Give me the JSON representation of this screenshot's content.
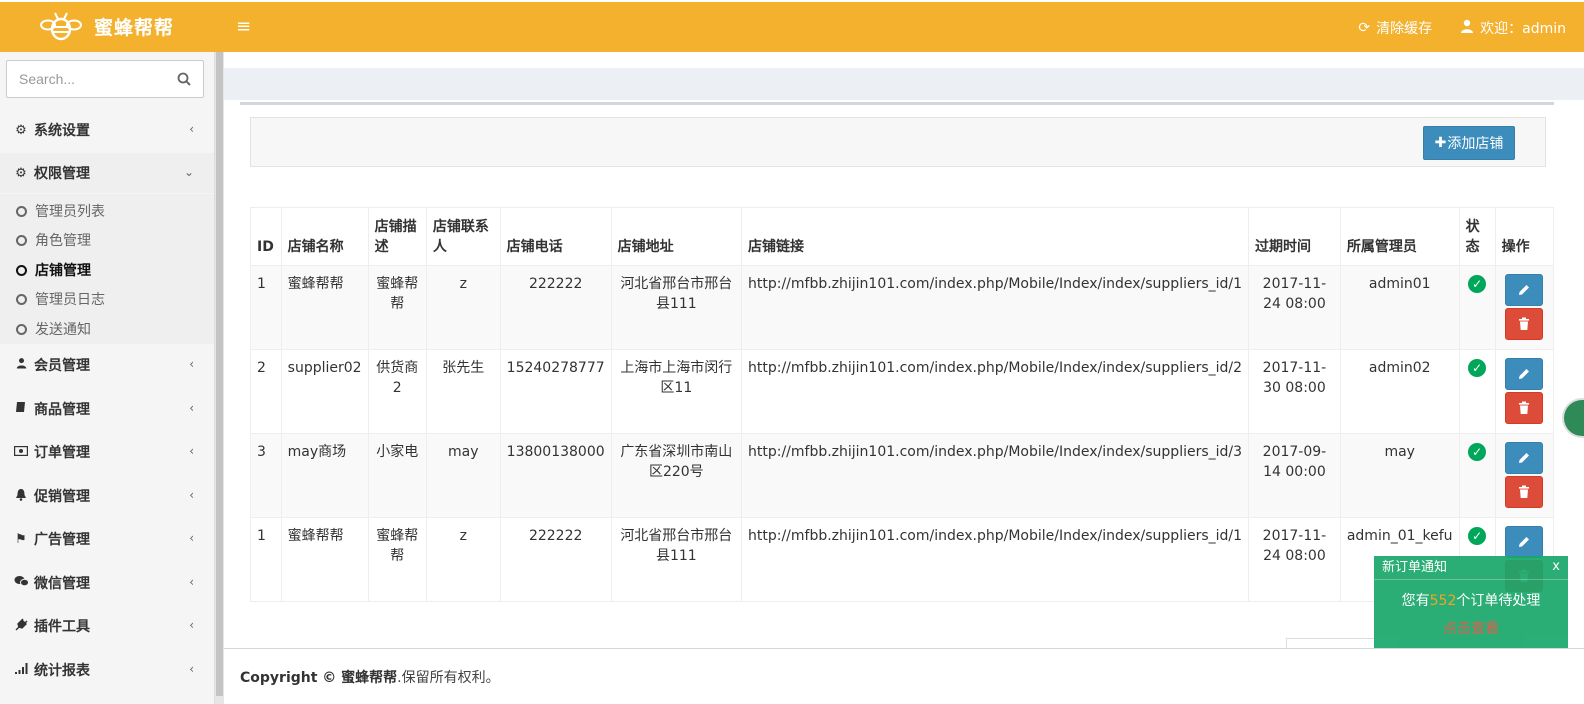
{
  "header": {
    "brand": "蜜蜂帮帮",
    "menu_toggle": "≡",
    "clear_cache": "清除缓存",
    "welcome": "欢迎：admin"
  },
  "sidebar": {
    "search_placeholder": "Search...",
    "items": [
      {
        "label": "系统设置",
        "icon": "gear-icon"
      },
      {
        "label": "权限管理",
        "icon": "gears-icon",
        "expanded": true
      },
      {
        "label": "会员管理",
        "icon": "user-icon"
      },
      {
        "label": "商品管理",
        "icon": "book-icon"
      },
      {
        "label": "订单管理",
        "icon": "money-icon"
      },
      {
        "label": "促销管理",
        "icon": "bell-icon"
      },
      {
        "label": "广告管理",
        "icon": "flag-icon"
      },
      {
        "label": "微信管理",
        "icon": "wechat-icon"
      },
      {
        "label": "插件工具",
        "icon": "plug-icon"
      },
      {
        "label": "统计报表",
        "icon": "signal-icon"
      }
    ],
    "submenu": [
      {
        "label": "管理员列表"
      },
      {
        "label": "角色管理"
      },
      {
        "label": "店铺管理",
        "active": true
      },
      {
        "label": "管理员日志"
      },
      {
        "label": "发送通知"
      }
    ]
  },
  "toolbar": {
    "add_label": "添加店铺"
  },
  "table": {
    "headers": [
      "ID",
      "店铺名称",
      "店铺描述",
      "店铺联系人",
      "店铺电话",
      "店铺地址",
      "店铺链接",
      "过期时间",
      "所属管理员",
      "状态",
      "操作"
    ],
    "rows": [
      {
        "id": "1",
        "name": "蜜蜂帮帮",
        "desc": "蜜蜂帮帮",
        "contact": "z",
        "phone": "222222",
        "address": "河北省邢台市邢台县111",
        "link": "http://mfbb.zhijin101.com/index.php/Mobile/Index/index/suppliers_id/1",
        "expire": "2017-11-24 08:00",
        "admin": "admin01",
        "status": "enabled"
      },
      {
        "id": "2",
        "name": "supplier02",
        "desc": "供货商2",
        "contact": "张先生",
        "phone": "15240278777",
        "address": "上海市上海市闵行区11",
        "link": "http://mfbb.zhijin101.com/index.php/Mobile/Index/index/suppliers_id/2",
        "expire": "2017-11-30 08:00",
        "admin": "admin02",
        "status": "enabled"
      },
      {
        "id": "3",
        "name": "may商场",
        "desc": "小家电",
        "contact": "may",
        "phone": "13800138000",
        "address": "广东省深圳市南山区220号",
        "link": "http://mfbb.zhijin101.com/index.php/Mobile/Index/index/suppliers_id/3",
        "expire": "2017-09-14 00:00",
        "admin": "may",
        "status": "enabled"
      },
      {
        "id": "1",
        "name": "蜜蜂帮帮",
        "desc": "蜜蜂帮帮",
        "contact": "z",
        "phone": "222222",
        "address": "河北省邢台市邢台县111",
        "link": "http://mfbb.zhijin101.com/index.php/Mobile/Index/index/suppliers_id/1",
        "expire": "2017-11-24 08:00",
        "admin": "admin_01_kefu",
        "status": "enabled"
      }
    ]
  },
  "footer": {
    "copyright_bold": "Copyright © 蜜蜂帮帮",
    "copyright_rest": ".保留所有权利。"
  },
  "notification": {
    "title": "新订单通知",
    "close": "x",
    "text_before": "您有",
    "count": "552",
    "text_after": "个订单待处理",
    "link": "点击查看"
  },
  "colors": {
    "header": "#f3b12e",
    "primary": "#3c8dbc",
    "danger": "#dd4b39",
    "success": "#00a65a",
    "notify_bg": "#1aa86b"
  }
}
